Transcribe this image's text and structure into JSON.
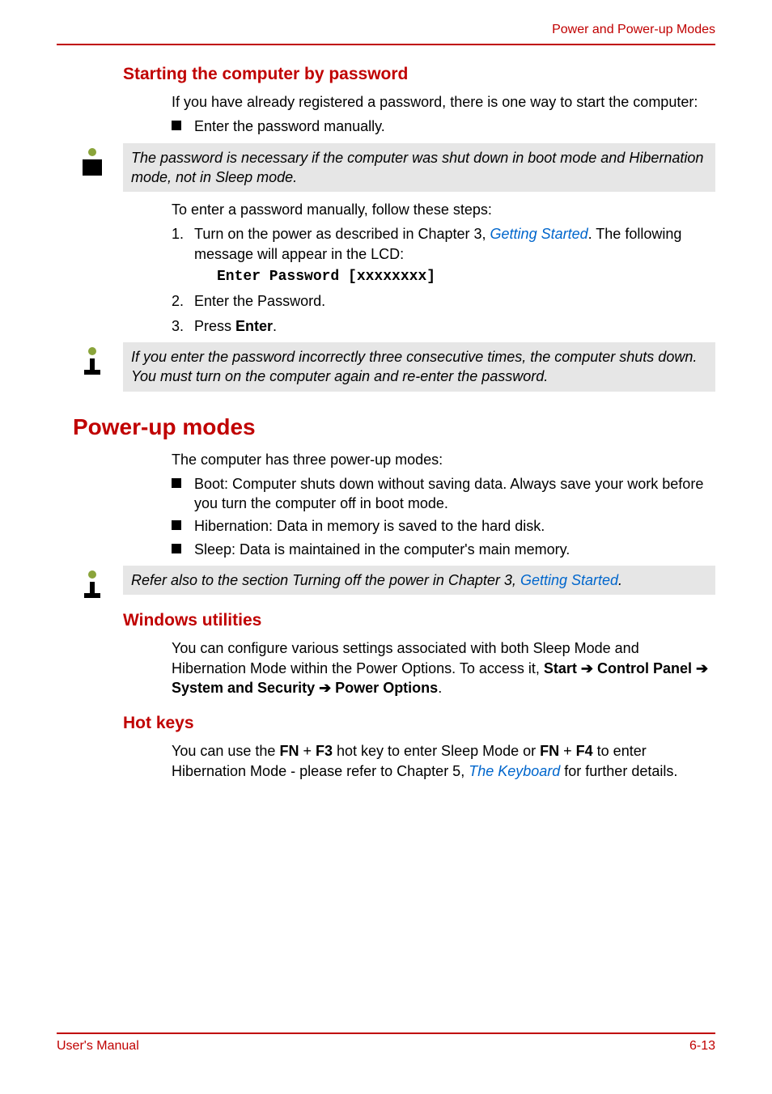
{
  "header": {
    "title": "Power and Power-up Modes"
  },
  "s1": {
    "heading": "Starting the computer by password",
    "intro": "If you have already registered a password, there is one way to start the computer:",
    "bullet1": "Enter the password manually.",
    "note1": "The password is necessary if the computer was shut down in boot mode and Hibernation mode, not in Sleep mode.",
    "lead2": "To enter a password manually, follow these steps:",
    "step1": {
      "num": "1.",
      "a": "Turn on the power as described in Chapter 3, ",
      "link": "Getting Started",
      "b": ". The following message will appear in the LCD:",
      "code": "Enter Password [xxxxxxxx]"
    },
    "step2": {
      "num": "2.",
      "text": "Enter the Password."
    },
    "step3": {
      "num": "3.",
      "a": "Press ",
      "bold": "Enter",
      "b": "."
    },
    "note2": "If you enter the password incorrectly three consecutive times, the computer shuts down. You must turn on the computer again and re-enter the password."
  },
  "s2": {
    "heading": "Power-up modes",
    "intro": "The computer has three power-up modes:",
    "b1": "Boot: Computer shuts down without saving data. Always save your work before you turn the computer off in boot mode.",
    "b2": "Hibernation: Data in memory is saved to the hard disk.",
    "b3": "Sleep: Data is maintained in the computer's main memory.",
    "note": {
      "a": "Refer also to the section Turning off the power in Chapter 3, ",
      "link": "Getting Started",
      "b": "."
    }
  },
  "s3": {
    "heading": "Windows utilities",
    "p": {
      "a": "You can configure various settings associated with both Sleep Mode and Hibernation Mode within the Power Options. To access it, ",
      "b1": "Start",
      "arr1": " ➔ ",
      "b2": "Control Panel",
      "arr2": " ➔ ",
      "b3": "System and Security",
      "arr3": " ➔ ",
      "b4": "Power Options",
      "end": "."
    }
  },
  "s4": {
    "heading": "Hot keys",
    "p": {
      "a": "You can use the ",
      "b1": "FN",
      "plus1": " + ",
      "b2": "F3",
      "c": " hot key to enter Sleep Mode or ",
      "b3": "FN",
      "plus2": " + ",
      "b4": "F4",
      "d": " to enter Hibernation Mode - please refer to Chapter 5, ",
      "link": "The Keyboard",
      "e": " for further details."
    }
  },
  "footer": {
    "left": "User's Manual",
    "right": "6-13"
  }
}
